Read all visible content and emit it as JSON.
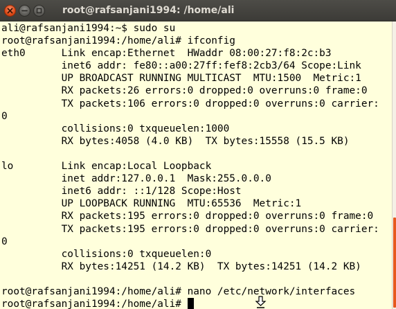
{
  "window": {
    "title": "root@rafsanjani1994: /home/ali"
  },
  "terminal": {
    "lines": [
      "ali@rafsanjani1994:~$ sudo su",
      "root@rafsanjani1994:/home/ali# ifconfig",
      "eth0      Link encap:Ethernet  HWaddr 08:00:27:f8:2c:b3",
      "          inet6 addr: fe80::a00:27ff:fef8:2cb3/64 Scope:Link",
      "          UP BROADCAST RUNNING MULTICAST  MTU:1500  Metric:1",
      "          RX packets:26 errors:0 dropped:0 overruns:0 frame:0",
      "          TX packets:106 errors:0 dropped:0 overruns:0 carrier:",
      "0",
      "          collisions:0 txqueuelen:1000",
      "          RX bytes:4058 (4.0 KB)  TX bytes:15558 (15.5 KB)",
      "",
      "lo        Link encap:Local Loopback",
      "          inet addr:127.0.0.1  Mask:255.0.0.0",
      "          inet6 addr: ::1/128 Scope:Host",
      "          UP LOOPBACK RUNNING  MTU:65536  Metric:1",
      "          RX packets:195 errors:0 dropped:0 overruns:0 frame:0",
      "          TX packets:195 errors:0 dropped:0 overruns:0 carrier:",
      "0",
      "          collisions:0 txqueuelen:0",
      "          RX bytes:14251 (14.2 KB)  TX bytes:14251 (14.2 KB)",
      "",
      "root@rafsanjani1994:/home/ali# nano /etc/network/interfaces",
      "root@rafsanjani1994:/home/ali# "
    ]
  },
  "colors": {
    "terminal_background": "#ffffdc",
    "titlebar": "#3c3b37",
    "close_button": "#df4a16",
    "scrollbar_thumb": "#e6591e"
  },
  "icons": {
    "close": "close-icon",
    "minimize": "minimize-icon",
    "maximize": "maximize-icon",
    "pointer": "mouse-pointer-icon"
  }
}
